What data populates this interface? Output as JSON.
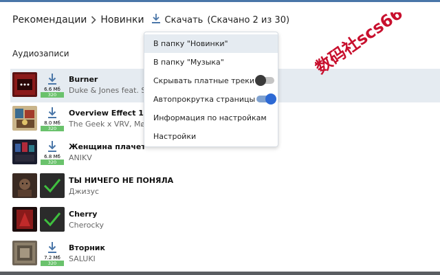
{
  "breadcrumb": {
    "items": [
      "Рекомендации",
      "Новинки"
    ],
    "download_label": "Скачать",
    "download_count": "(Скачано 2 из 30)"
  },
  "section_title": "Аудиозаписи",
  "tracks": [
    {
      "title": "Burner",
      "artist": "Duke & Jones feat. Sc",
      "size": "6.6 Мб",
      "bitrate": "320",
      "downloaded": false,
      "active": true
    },
    {
      "title": "Overview Effect 1972",
      "artist": "The Geek x VRV, Møn",
      "size": "8.0 Мб",
      "bitrate": "320",
      "downloaded": false,
      "active": false
    },
    {
      "title": "Женщина плачет",
      "artist": "ANIKV",
      "size": "6.8 Мб",
      "bitrate": "320",
      "downloaded": false,
      "active": false
    },
    {
      "title": "ТЫ НИЧЕГО НЕ ПОНЯЛА",
      "artist": "Джизус",
      "downloaded": true,
      "active": false
    },
    {
      "title": "Cherry",
      "artist": "Cherocky",
      "downloaded": true,
      "active": false
    },
    {
      "title": "Вторник",
      "artist": "SALUKI",
      "size": "7.2 Мб",
      "bitrate": "320",
      "downloaded": false,
      "active": false
    }
  ],
  "menu": {
    "items": [
      {
        "label": "В папку \"Новинки\""
      },
      {
        "label": "В папку \"Музыка\""
      },
      {
        "label": "Скрывать платные треки",
        "toggle": false
      },
      {
        "label": "Автопрокрутка страницы",
        "toggle": true
      },
      {
        "label": "Информация по настройкам"
      },
      {
        "label": "Настройки"
      }
    ]
  },
  "watermark": {
    "text": "数码社scs66"
  },
  "colors": {
    "accent": "#4a76a8",
    "bitrate": "#6ac26c",
    "toggle_on": "#2d69d4",
    "watermark": "#c8102e"
  }
}
